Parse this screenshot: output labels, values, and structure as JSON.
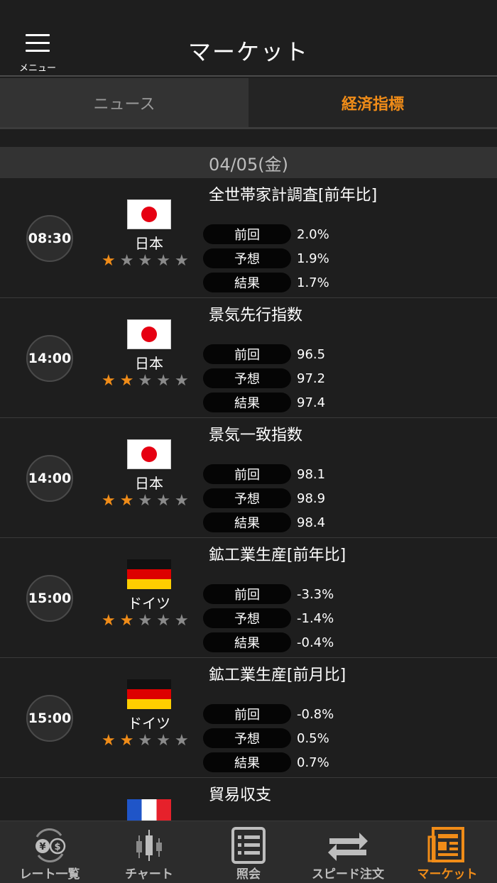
{
  "header": {
    "title": "マーケット",
    "menu_label": "メニュー"
  },
  "tabs": [
    {
      "label": "ニュース",
      "active": false
    },
    {
      "label": "経済指標",
      "active": true
    }
  ],
  "date": "04/05(金)",
  "labels": {
    "previous": "前回",
    "forecast": "予想",
    "result": "結果"
  },
  "events": [
    {
      "time": "08:30",
      "country": "日本",
      "flag": "jp",
      "importance": 1,
      "title": "全世帯家計調査[前年比]",
      "previous": "2.0%",
      "forecast": "1.9%",
      "result": "1.7%"
    },
    {
      "time": "14:00",
      "country": "日本",
      "flag": "jp",
      "importance": 2,
      "title": "景気先行指数",
      "previous": "96.5",
      "forecast": "97.2",
      "result": "97.4"
    },
    {
      "time": "14:00",
      "country": "日本",
      "flag": "jp",
      "importance": 2,
      "title": "景気一致指数",
      "previous": "98.1",
      "forecast": "98.9",
      "result": "98.4"
    },
    {
      "time": "15:00",
      "country": "ドイツ",
      "flag": "de",
      "importance": 2,
      "title": "鉱工業生産[前年比]",
      "previous": "-3.3%",
      "forecast": "-1.4%",
      "result": "-0.4%"
    },
    {
      "time": "15:00",
      "country": "ドイツ",
      "flag": "de",
      "importance": 2,
      "title": "鉱工業生産[前月比]",
      "previous": "-0.8%",
      "forecast": "0.5%",
      "result": "0.7%"
    },
    {
      "time": "",
      "country": "",
      "flag": "fr",
      "importance": 0,
      "title": "貿易収支",
      "previous": "",
      "forecast": "",
      "result": ""
    }
  ],
  "bottom_nav": [
    {
      "label": "レート一覧",
      "icon": "rates-icon",
      "active": false
    },
    {
      "label": "チャート",
      "icon": "chart-icon",
      "active": false
    },
    {
      "label": "照会",
      "icon": "inquiry-icon",
      "active": false
    },
    {
      "label": "スピード注文",
      "icon": "speed-order-icon",
      "active": false
    },
    {
      "label": "マーケット",
      "icon": "market-icon",
      "active": true
    }
  ],
  "colors": {
    "accent": "#f08c18",
    "background": "#1e1e1e"
  }
}
